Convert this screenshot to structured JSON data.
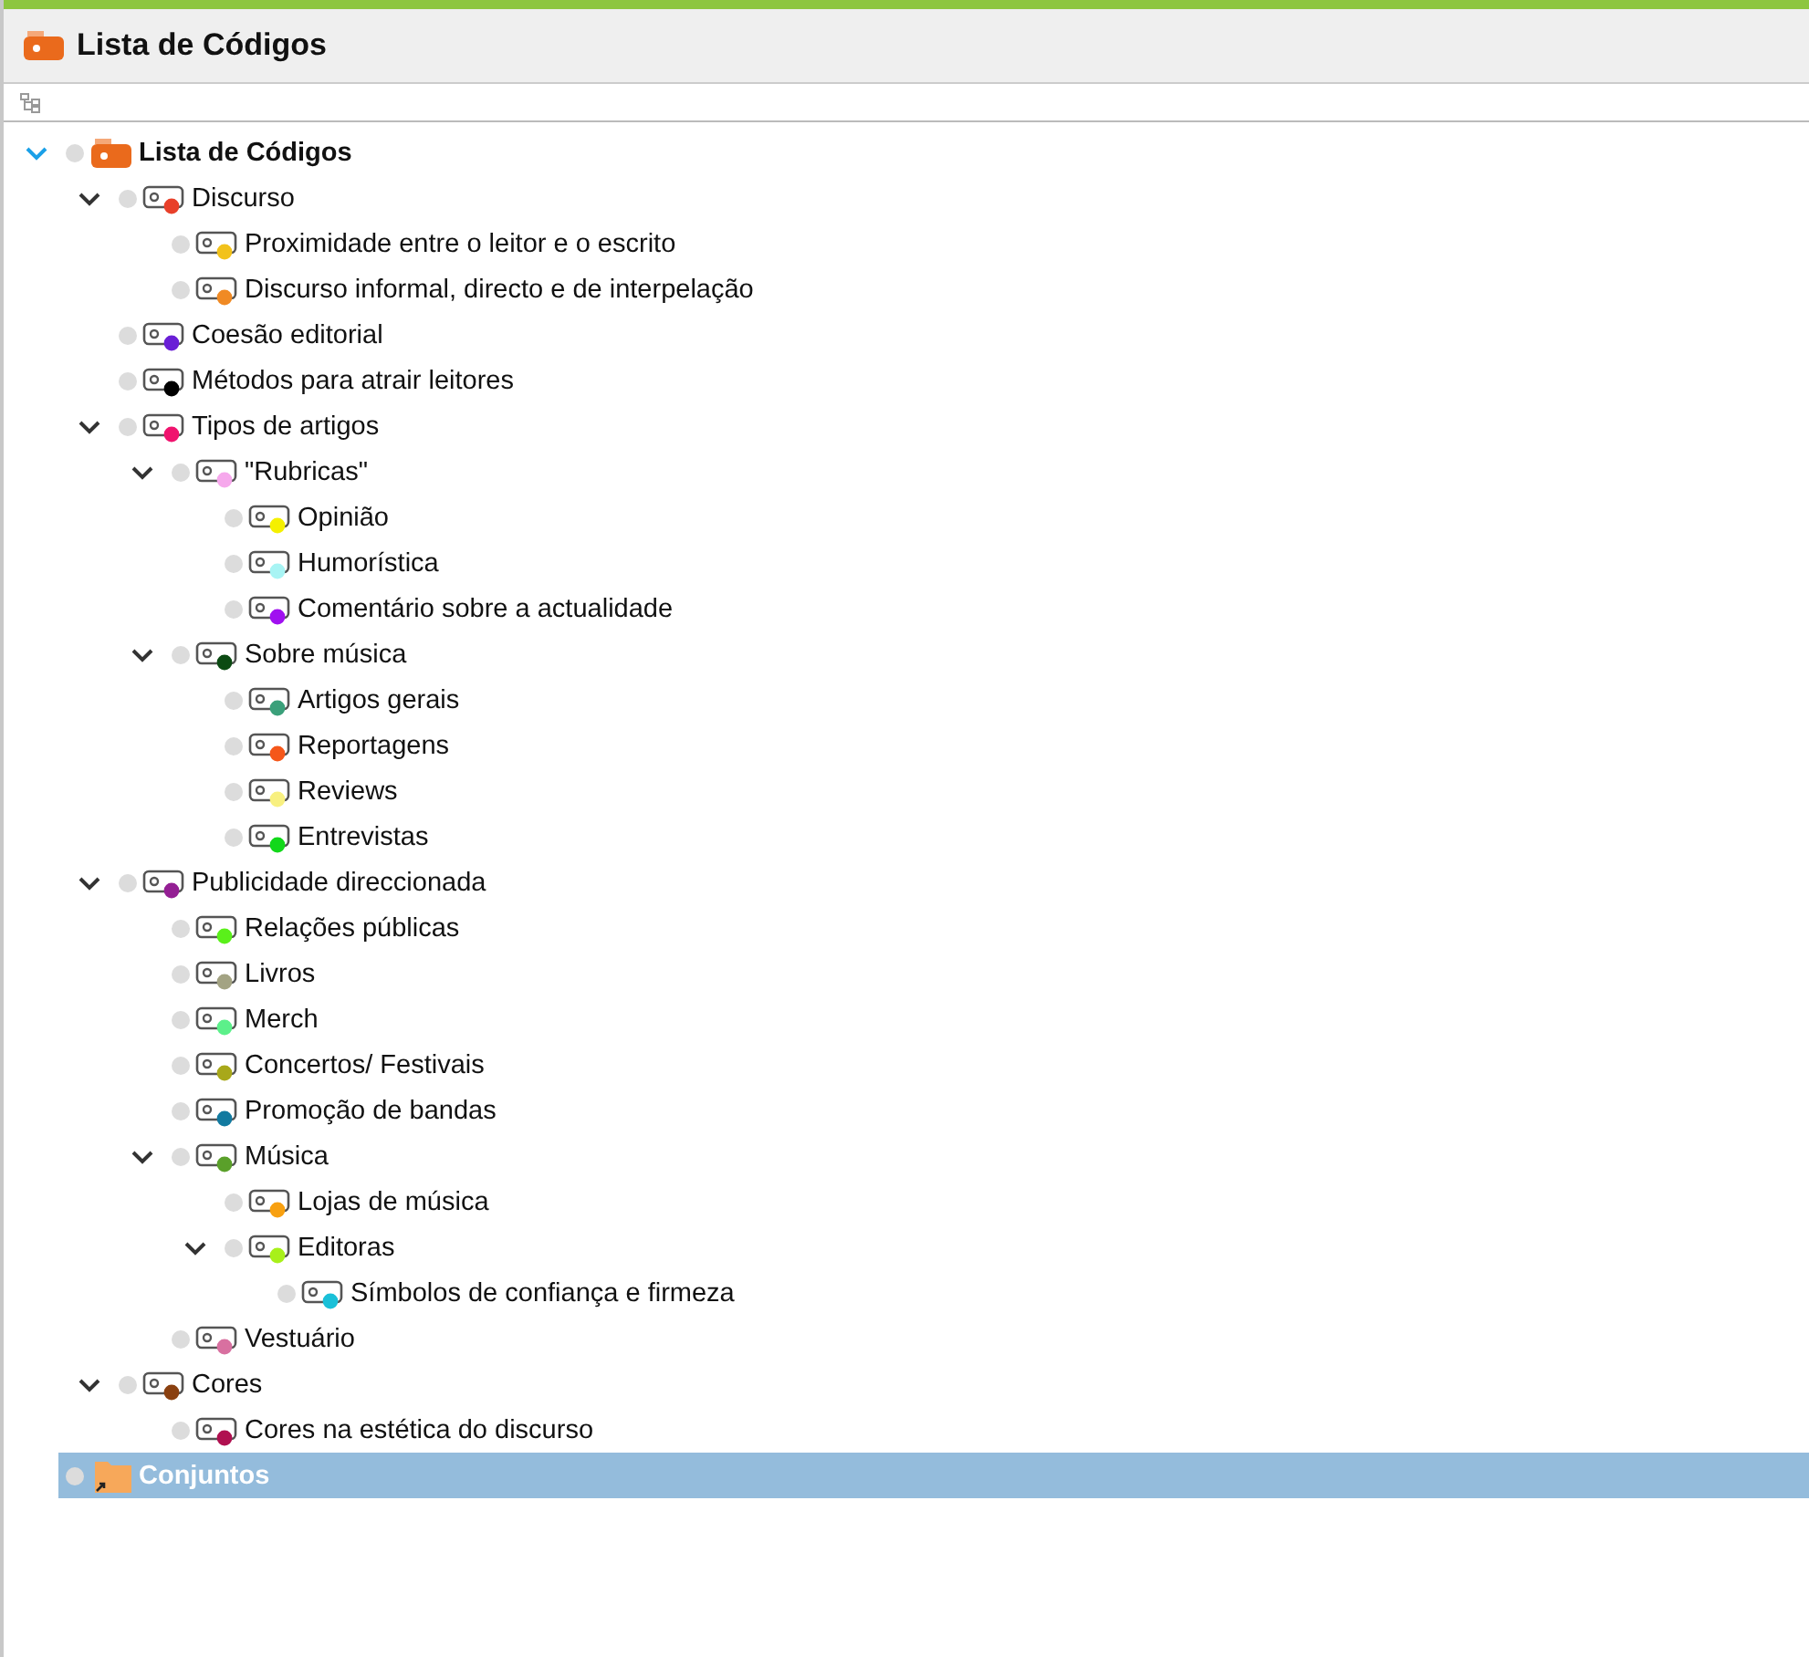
{
  "window": {
    "title": "Lista de Códigos"
  },
  "tree": [
    {
      "kind": "root",
      "label": "Lista de Códigos",
      "expanded": true,
      "selected": false,
      "children": [
        {
          "kind": "code",
          "label": "Discurso",
          "color": "#e8402a",
          "expanded": true,
          "selected": false,
          "children": [
            {
              "kind": "code",
              "label": "Proximidade entre o leitor e o escrito",
              "color": "#f2c21b",
              "selected": false
            },
            {
              "kind": "code",
              "label": "Discurso informal, directo e de interpelação",
              "color": "#f08a24",
              "selected": false
            }
          ]
        },
        {
          "kind": "code",
          "label": "Coesão editorial",
          "color": "#6a1fd6",
          "selected": false
        },
        {
          "kind": "code",
          "label": "Métodos para atrair leitores",
          "color": "#000000",
          "selected": false
        },
        {
          "kind": "code",
          "label": "Tipos de artigos",
          "color": "#f0136e",
          "expanded": true,
          "selected": false,
          "children": [
            {
              "kind": "code",
              "label": "\"Rubricas\"",
              "color": "#f6a8ec",
              "expanded": true,
              "selected": false,
              "children": [
                {
                  "kind": "code",
                  "label": "Opinião",
                  "color": "#f5f000",
                  "selected": false
                },
                {
                  "kind": "code",
                  "label": "Humorística",
                  "color": "#a8f4f4",
                  "selected": false
                },
                {
                  "kind": "code",
                  "label": "Comentário sobre a actualidade",
                  "color": "#a010f0",
                  "selected": false
                }
              ]
            },
            {
              "kind": "code",
              "label": "Sobre música",
              "color": "#0b4a12",
              "expanded": true,
              "selected": false,
              "children": [
                {
                  "kind": "code",
                  "label": "Artigos gerais",
                  "color": "#3aa07a",
                  "selected": false
                },
                {
                  "kind": "code",
                  "label": "Reportagens",
                  "color": "#f5571a",
                  "selected": false
                },
                {
                  "kind": "code",
                  "label": "Reviews",
                  "color": "#f8f080",
                  "selected": false
                },
                {
                  "kind": "code",
                  "label": "Entrevistas",
                  "color": "#12d81a",
                  "selected": false
                }
              ]
            }
          ]
        },
        {
          "kind": "code",
          "label": "Publicidade direccionada",
          "color": "#941f94",
          "expanded": true,
          "selected": false,
          "children": [
            {
              "kind": "code",
              "label": "Relações públicas",
              "color": "#5af01a",
              "selected": false
            },
            {
              "kind": "code",
              "label": "Livros",
              "color": "#a3a383",
              "selected": false
            },
            {
              "kind": "code",
              "label": "Merch",
              "color": "#5cf08a",
              "selected": false
            },
            {
              "kind": "code",
              "label": "Concertos/ Festivais",
              "color": "#a8a81a",
              "selected": false
            },
            {
              "kind": "code",
              "label": "Promoção de bandas",
              "color": "#127aa0",
              "selected": false
            },
            {
              "kind": "code",
              "label": "Música",
              "color": "#5aa02a",
              "expanded": true,
              "selected": false,
              "children": [
                {
                  "kind": "code",
                  "label": "Lojas de música",
                  "color": "#f8a010",
                  "selected": false
                },
                {
                  "kind": "code",
                  "label": "Editoras",
                  "color": "#a8f01a",
                  "expanded": true,
                  "selected": false,
                  "children": [
                    {
                      "kind": "code",
                      "label": "Símbolos de confiança e firmeza",
                      "color": "#1ac0d8",
                      "selected": false
                    }
                  ]
                }
              ]
            },
            {
              "kind": "code",
              "label": "Vestuário",
              "color": "#d870a0",
              "selected": false
            }
          ]
        },
        {
          "kind": "code",
          "label": "Cores",
          "color": "#8a4010",
          "expanded": true,
          "selected": false,
          "children": [
            {
              "kind": "code",
              "label": "Cores na estética do discurso",
              "color": "#b01050",
              "selected": false
            }
          ]
        }
      ]
    },
    {
      "kind": "set",
      "label": "Conjuntos",
      "selected": true
    }
  ]
}
